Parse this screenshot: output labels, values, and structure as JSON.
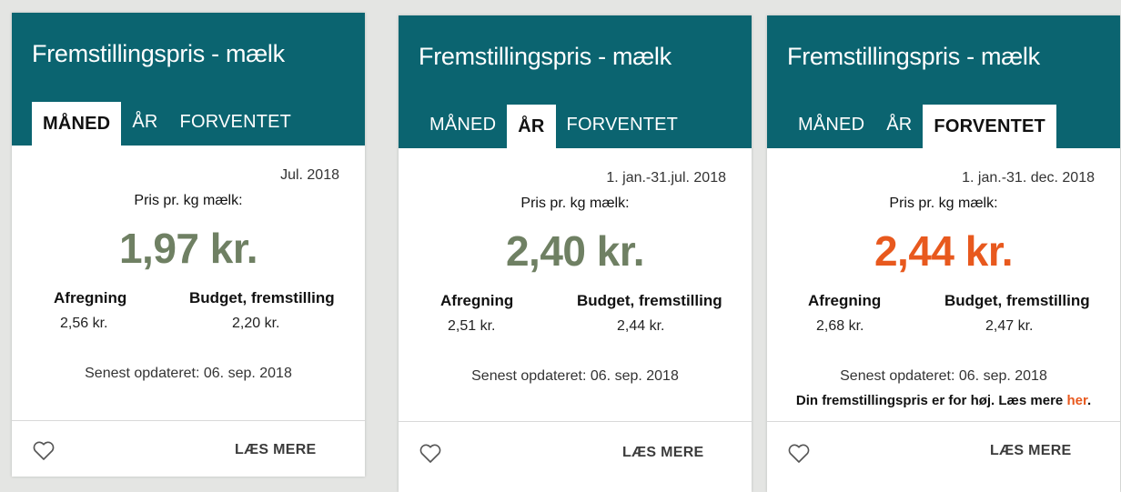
{
  "colors": {
    "header": "#0b6470",
    "price_normal": "#6f8063",
    "price_alert": "#e8591e",
    "link": "#e8591e"
  },
  "cards": [
    {
      "title": "Fremstillingspris - mælk",
      "tabs": [
        "MÅNED",
        "ÅR",
        "FORVENTET"
      ],
      "active_tab": 0,
      "period": "Jul. 2018",
      "price_label": "Pris pr. kg mælk:",
      "price": "1,97 kr.",
      "settlement_label": "Afregning",
      "settlement_value": "2,56 kr.",
      "budget_label": "Budget, fremstilling",
      "budget_value": "2,20 kr.",
      "updated": "Senest opdateret: 06. sep. 2018",
      "read_more": "LÆS MERE"
    },
    {
      "title": "Fremstillingspris - mælk",
      "tabs": [
        "MÅNED",
        "ÅR",
        "FORVENTET"
      ],
      "active_tab": 1,
      "period": "1. jan.-31.jul. 2018",
      "price_label": "Pris pr. kg mælk:",
      "price": "2,40 kr.",
      "settlement_label": "Afregning",
      "settlement_value": "2,51 kr.",
      "budget_label": "Budget, fremstilling",
      "budget_value": "2,44 kr.",
      "updated": "Senest opdateret: 06. sep. 2018",
      "read_more": "LÆS MERE"
    },
    {
      "title": "Fremstillingspris - mælk",
      "tabs": [
        "MÅNED",
        "ÅR",
        "FORVENTET"
      ],
      "active_tab": 2,
      "period": "1. jan.-31. dec. 2018",
      "price_label": "Pris pr. kg mælk:",
      "price": "2,44 kr.",
      "settlement_label": "Afregning",
      "settlement_value": "2,68 kr.",
      "budget_label": "Budget, fremstilling",
      "budget_value": "2,47 kr.",
      "updated": "Senest opdateret: 06. sep. 2018",
      "warning_text": "Din fremstillingspris er for høj. Læs mere",
      "warning_link": "her",
      "warning_end": ".",
      "read_more": "LÆS MERE"
    }
  ]
}
